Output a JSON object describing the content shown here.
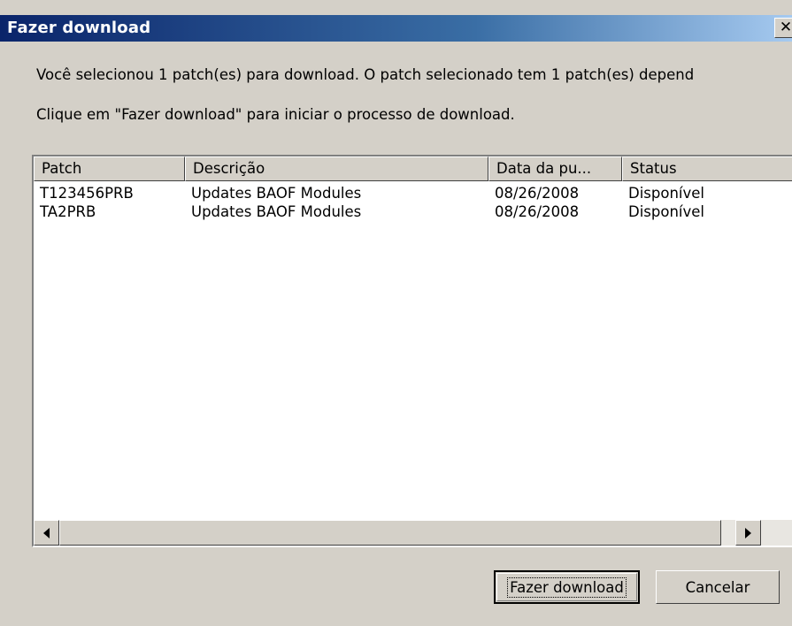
{
  "dialog": {
    "title": "Fazer download",
    "close_icon": "close-icon",
    "message_line1": "Você selecionou 1 patch(es) para download. O patch selecionado tem 1 patch(es) depend",
    "message_line2": "Clique em \"Fazer download\" para iniciar o processo de download."
  },
  "table": {
    "columns": [
      "Patch",
      "Descrição",
      "Data da pu...",
      "Status"
    ],
    "rows": [
      [
        "T123456PRB",
        "Updates BAOF Modules",
        "08/26/2008",
        "Disponível"
      ],
      [
        "TA2PRB",
        "Updates BAOF Modules",
        "08/26/2008",
        "Disponível"
      ]
    ]
  },
  "buttons": {
    "download": "Fazer download",
    "cancel": "Cancelar"
  },
  "colors": {
    "title_gradient_start": "#0a246a",
    "title_gradient_end": "#a6caf0",
    "dialog_face": "#d4d0c8"
  }
}
